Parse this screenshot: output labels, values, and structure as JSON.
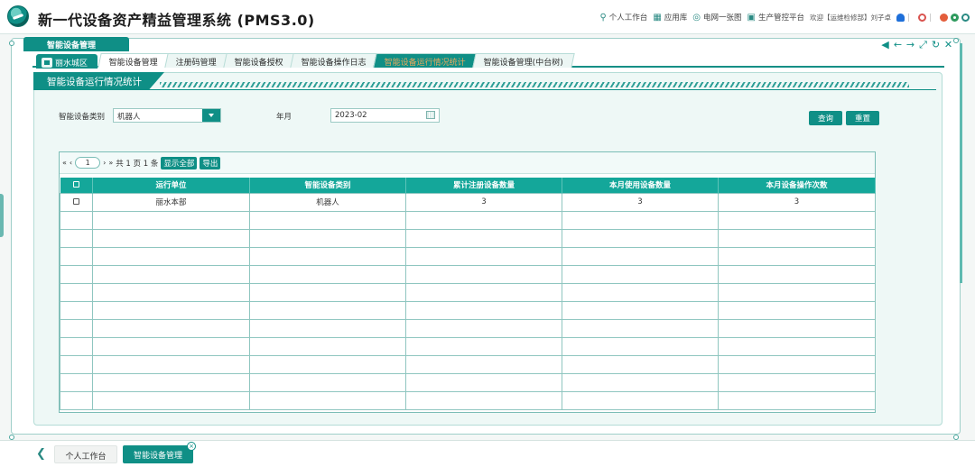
{
  "app": {
    "title": "新一代设备资产精益管理系统 (PMS3.0)"
  },
  "header_links": {
    "personal_workbench": "个人工作台",
    "app_library": "应用库",
    "grid_map": "电网一张图",
    "production_platform": "生产管控平台",
    "welcome": "欢迎【运维检修部】刘子卓"
  },
  "module": {
    "label": "智能设备管理"
  },
  "region": {
    "label": "丽水城区"
  },
  "tabs": [
    {
      "label": "智能设备管理"
    },
    {
      "label": "注册码管理"
    },
    {
      "label": "智能设备授权"
    },
    {
      "label": "智能设备操作日志"
    },
    {
      "label": "智能设备运行情况统计"
    },
    {
      "label": "智能设备管理(中台树)"
    }
  ],
  "panel": {
    "title": "智能设备运行情况统计"
  },
  "filters": {
    "device_type_label": "智能设备类别",
    "device_type_value": "机器人",
    "month_label": "年月",
    "month_value": "2023-02"
  },
  "buttons": {
    "query": "查询",
    "reset": "重置"
  },
  "pager": {
    "page_number": "1",
    "total_text": "共 1 页 1 条",
    "show_all": "显示全部",
    "export": "导出"
  },
  "table": {
    "columns": [
      "运行单位",
      "智能设备类别",
      "累计注册设备数量",
      "本月使用设备数量",
      "本月设备操作次数"
    ],
    "rows": [
      [
        "丽水本部",
        "机器人",
        "3",
        "3",
        "3"
      ]
    ],
    "empty_rows": 11
  },
  "taskbar": {
    "home_label": "个人工作台",
    "current_label": "智能设备管理"
  },
  "colors": {
    "accent": "#0f8f86",
    "header_teal": "#14a79a",
    "active_tab_text": "#e8a95f"
  }
}
